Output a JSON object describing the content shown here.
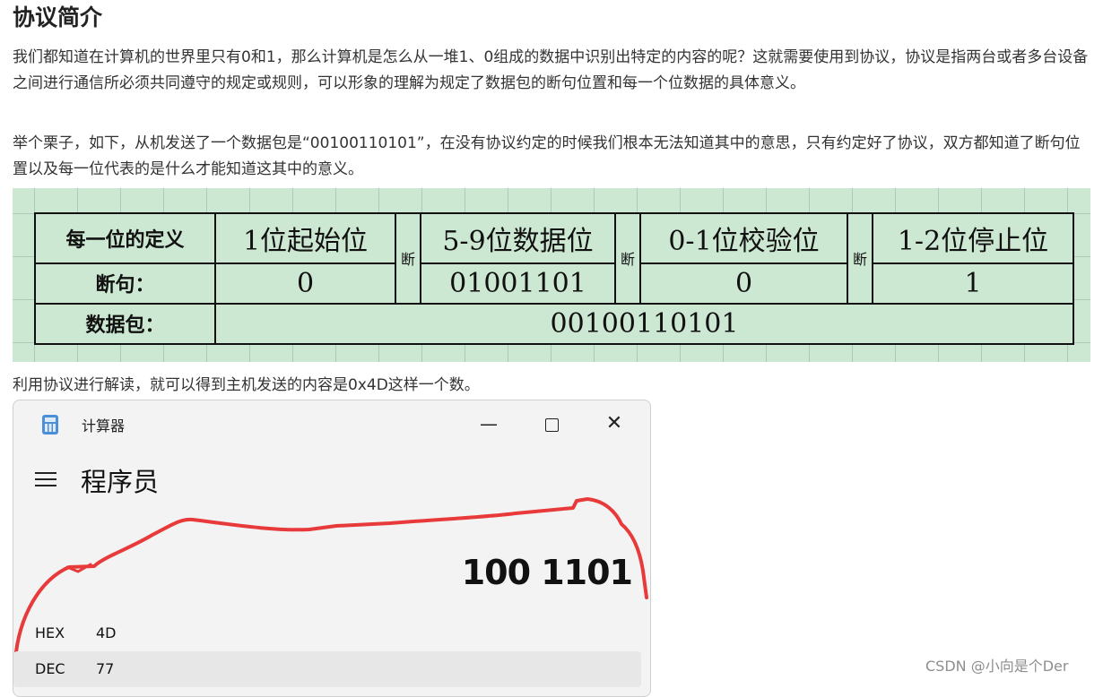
{
  "heading": "协议简介",
  "paragraphs": {
    "p1": "我们都知道在计算机的世界里只有0和1，那么计算机是怎么从一堆1、0组成的数据中识别出特定的内容的呢？这就需要使用到协议，协议是指两台或者多台设备之间进行通信所必须共同遵守的规定或规则，可以形象的理解为规定了数据包的断句位置和每一个位数据的具体意义。",
    "p2": "举个栗子，如下，从机发送了一个数据包是“00100110101”，在没有协议约定的时候我们根本无法知道其中的意思，只有约定好了协议，双方都知道了断句位置以及每一位代表的是什么才能知道这其中的意义。",
    "p3": "利用协议进行解读，就可以得到主机发送的内容是0x4D这样一个数。"
  },
  "table": {
    "row_labels": [
      "每一位的定义",
      "断句：",
      "数据包："
    ],
    "field_names": [
      "1位起始位",
      "5-9位数据位",
      "0-1位校验位",
      "1-2位停止位"
    ],
    "break_label": "断",
    "field_values": [
      "0",
      "01001101",
      "0",
      "1"
    ],
    "packet": "00100110101"
  },
  "calculator": {
    "window_title": "计算器",
    "mode": "程序员",
    "controls": {
      "minimize": "—",
      "close": "✕"
    },
    "display": "100 1101",
    "radix": [
      {
        "label": "HEX",
        "value": "4D"
      },
      {
        "label": "DEC",
        "value": "77"
      }
    ]
  },
  "watermark": "CSDN @小向是个Der",
  "colors": {
    "sheet_bg": "#cde8d2",
    "scribble": "#e83a3a"
  }
}
